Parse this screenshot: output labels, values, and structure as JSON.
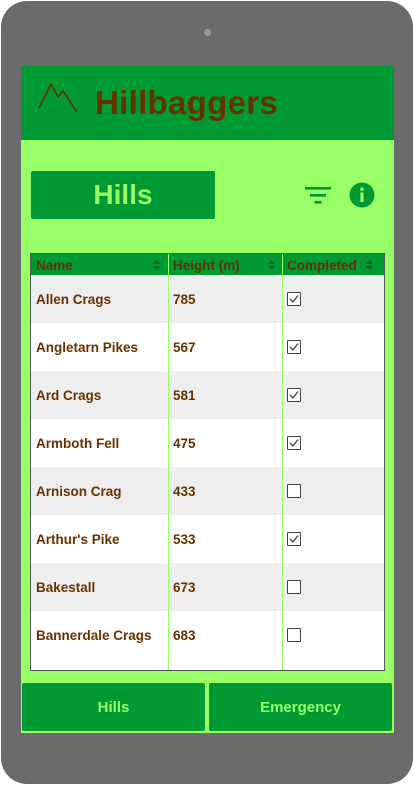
{
  "app": {
    "title": "Hillbaggers",
    "logo_icon": "mountain-icon"
  },
  "page": {
    "header": "Hills"
  },
  "toolbar": {
    "filter_icon": "filter-icon",
    "info_icon": "info-icon"
  },
  "table": {
    "columns": [
      "Name",
      "Height (m)",
      "Completed"
    ],
    "rows": [
      {
        "name": "Allen Crags",
        "height": "785",
        "completed": true
      },
      {
        "name": "Angletarn Pikes",
        "height": "567",
        "completed": true
      },
      {
        "name": "Ard Crags",
        "height": "581",
        "completed": true
      },
      {
        "name": "Armboth Fell",
        "height": "475",
        "completed": true
      },
      {
        "name": "Arnison Crag",
        "height": "433",
        "completed": false
      },
      {
        "name": "Arthur's Pike",
        "height": "533",
        "completed": true
      },
      {
        "name": "Bakestall",
        "height": "673",
        "completed": false
      },
      {
        "name": "Bannerdale Crags",
        "height": "683",
        "completed": false
      }
    ]
  },
  "bottom_nav": {
    "hills_label": "Hills",
    "emergency_label": "Emergency"
  },
  "colors": {
    "primary": "#009933",
    "background": "#99ff66",
    "text_brown": "#663300",
    "device_frame": "#6b6b6b"
  }
}
